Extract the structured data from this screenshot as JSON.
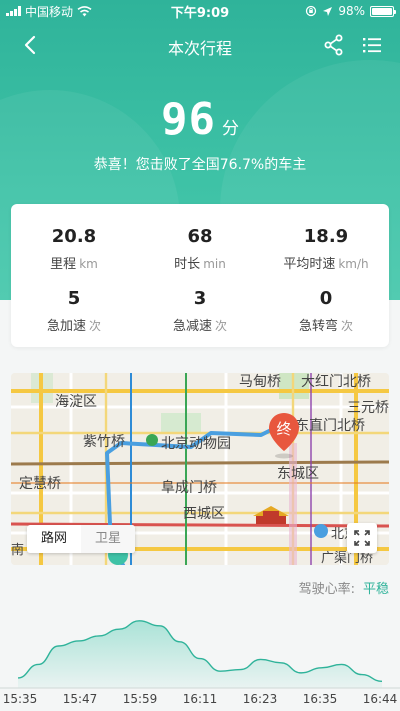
{
  "status_bar": {
    "carrier": "中国移动",
    "time": "下午9:09",
    "battery": "98%"
  },
  "nav": {
    "title": "本次行程",
    "back_icon": "chevron-left-icon",
    "share_icon": "share-icon",
    "menu_icon": "list-icon"
  },
  "score": {
    "value": "96",
    "unit": "分",
    "congrats": "恭喜！您击败了全国76.7%的车主"
  },
  "stats": [
    {
      "value": "20.8",
      "label": "里程",
      "unit": "km"
    },
    {
      "value": "68",
      "label": "时长",
      "unit": "min"
    },
    {
      "value": "18.9",
      "label": "平均时速",
      "unit": "km/h"
    },
    {
      "value": "5",
      "label": "急加速",
      "unit": "次"
    },
    {
      "value": "3",
      "label": "急减速",
      "unit": "次"
    },
    {
      "value": "0",
      "label": "急转弯",
      "unit": "次"
    }
  ],
  "map": {
    "labels": [
      "马甸桥",
      "大红门北桥",
      "海淀区",
      "三元桥",
      "东直门北桥",
      "紫竹桥",
      "北京动物园",
      "东城区",
      "定慧桥",
      "阜成门桥",
      "西城区",
      "南",
      "北京站",
      "广渠门桥"
    ],
    "end_marker": "终",
    "mode_road": "路网",
    "mode_satellite": "卫星",
    "expand_icon": "expand-icon"
  },
  "heart_rate": {
    "label": "驾驶心率:",
    "value": "平稳",
    "times": [
      "15:35",
      "15:47",
      "15:59",
      "16:11",
      "16:23",
      "16:35",
      "16:44"
    ],
    "curve_samples": [
      0.12,
      0.28,
      0.5,
      0.56,
      0.62,
      0.7,
      0.8,
      0.74,
      0.55,
      0.35,
      0.2,
      0.22,
      0.34,
      0.3,
      0.18,
      0.24,
      0.28,
      0.16,
      0.08
    ]
  },
  "colors": {
    "primary": "#2fb39a",
    "route": "#4a9fe0",
    "marker": "#e8573e"
  }
}
